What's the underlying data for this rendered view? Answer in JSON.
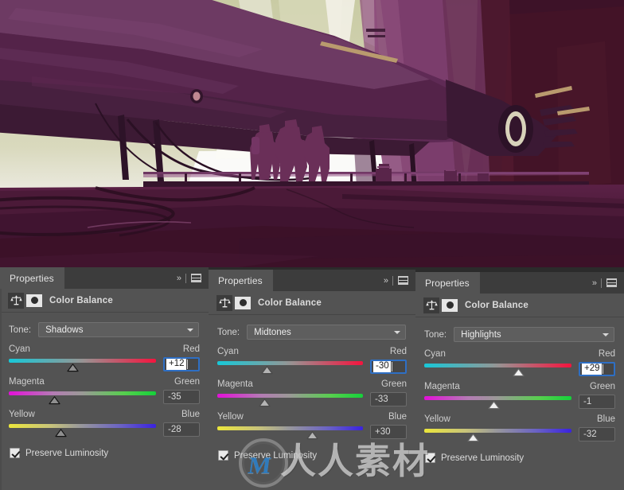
{
  "app": {
    "artwork_alt": "sci-fi concept painting of three figures on a platform beneath a large purple airship"
  },
  "panels": [
    {
      "tab_label": "Properties",
      "collapse_icon": "chevron-double-right-icon",
      "menu_icon": "panel-menu-icon",
      "adjustment_icon": "color-balance-icon",
      "mask_icon": "layer-mask-icon",
      "adjustment_title": "Color Balance",
      "tone": {
        "label": "Tone:",
        "value": "Shadows"
      },
      "sliders": [
        {
          "left_label": "Cyan",
          "right_label": "Red",
          "value": "+12",
          "position_pct": 43,
          "track": "cyanred"
        },
        {
          "left_label": "Magenta",
          "right_label": "Green",
          "value": "-35",
          "position_pct": 31,
          "track": "magreen"
        },
        {
          "left_label": "Yellow",
          "right_label": "Blue",
          "value": "-28",
          "position_pct": 35,
          "track": "yelblue"
        }
      ],
      "focused_slider_index": 0,
      "preserve_luminosity": {
        "label": "Preserve Luminosity",
        "checked": true
      }
    },
    {
      "tab_label": "Properties",
      "collapse_icon": "chevron-double-right-icon",
      "menu_icon": "panel-menu-icon",
      "adjustment_icon": "color-balance-icon",
      "mask_icon": "layer-mask-icon",
      "adjustment_title": "Color Balance",
      "tone": {
        "label": "Tone:",
        "value": "Midtones"
      },
      "sliders": [
        {
          "left_label": "Cyan",
          "right_label": "Red",
          "value": "-30",
          "position_pct": 34,
          "track": "cyanred"
        },
        {
          "left_label": "Magenta",
          "right_label": "Green",
          "value": "-33",
          "position_pct": 32,
          "track": "magreen"
        },
        {
          "left_label": "Yellow",
          "right_label": "Blue",
          "value": "+30",
          "position_pct": 65,
          "track": "yelblue"
        }
      ],
      "focused_slider_index": 0,
      "preserve_luminosity": {
        "label": "Preserve Luminosity",
        "checked": true
      }
    },
    {
      "tab_label": "Properties",
      "collapse_icon": "chevron-double-right-icon",
      "menu_icon": "panel-menu-icon",
      "adjustment_icon": "color-balance-icon",
      "mask_icon": "layer-mask-icon",
      "adjustment_title": "Color Balance",
      "tone": {
        "label": "Tone:",
        "value": "Highlights"
      },
      "sliders": [
        {
          "left_label": "Cyan",
          "right_label": "Red",
          "value": "+29",
          "position_pct": 64,
          "track": "cyanred"
        },
        {
          "left_label": "Magenta",
          "right_label": "Green",
          "value": "-1",
          "position_pct": 47,
          "track": "magreen"
        },
        {
          "left_label": "Yellow",
          "right_label": "Blue",
          "value": "-32",
          "position_pct": 33,
          "track": "yelblue"
        }
      ],
      "focused_slider_index": 0,
      "preserve_luminosity": {
        "label": "Preserve Luminosity",
        "checked": true
      }
    }
  ],
  "watermark": {
    "logo_letter": "M",
    "text": "人人素材"
  },
  "colors": {
    "panel_bg": "#535353",
    "tabstrip_bg": "#3c3c3c",
    "focus_border": "#2e6fc4",
    "text": "#dcdcdc"
  }
}
